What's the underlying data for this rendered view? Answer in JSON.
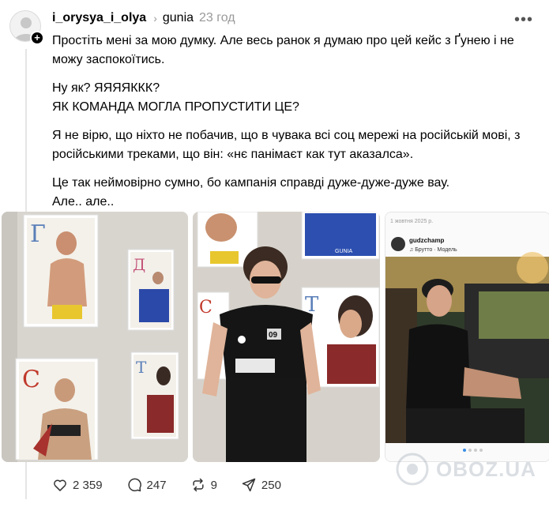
{
  "post": {
    "username": "i_orysya_i_olya",
    "topic": "gunia",
    "time": "23 год",
    "paragraphs": [
      "Простіть мені за мою думку. Але весь ранок я думаю про цей кейс з Ґунею і не можу заспокоїтись.",
      "Ну як? ЯЯЯЯККК?",
      "ЯК КОМАНДА МОГЛА ПРОПУСТИТИ ЦЕ?",
      "Я не вірю, що ніхто не побачив, що в чувака всі соц мережі на російській мові, з російськими треками, що він: «нє панімаєт как тут аказалса».",
      "Це так неймовірно сумно, бо кампанія справді дуже-дуже-дуже вау.",
      "Але.. але.."
    ]
  },
  "photos": {
    "poster_letters": [
      "Г",
      "Д",
      "С",
      "Т"
    ],
    "brand": "GUNIA",
    "shirt_number": "09",
    "screenshot": {
      "date": "1 жовтня 2025 р.",
      "account": "gudzchamp",
      "song": "♫ Брутто · Модель"
    }
  },
  "actions": {
    "likes": "2 359",
    "comments": "247",
    "reposts": "9",
    "shares": "250"
  },
  "watermark": "OBOZ.UA",
  "icons": {
    "avatar": "person-icon",
    "follow": "plus-icon",
    "chevron": "chevron-right-icon",
    "more": "more-horizontal-icon",
    "like": "heart-icon",
    "comment": "comment-icon",
    "repost": "repost-icon",
    "share": "share-icon"
  }
}
